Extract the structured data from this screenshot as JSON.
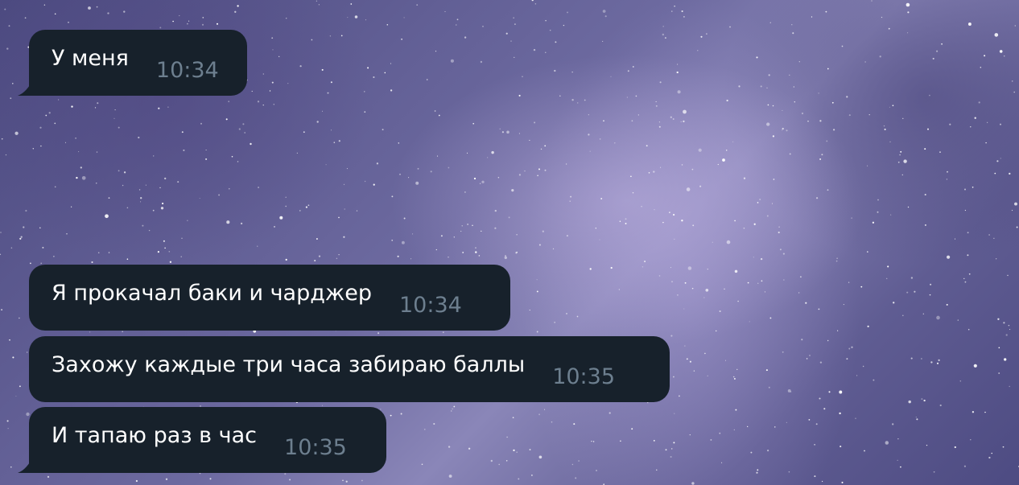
{
  "messages": [
    {
      "text": "У меня",
      "time": "10:34"
    },
    {
      "text": "Я прокачал баки и чарджер",
      "time": "10:34"
    },
    {
      "text": "Захожу каждые три часа забираю баллы",
      "time": "10:35"
    },
    {
      "text": "И тапаю раз в час",
      "time": "10:35"
    }
  ],
  "colors": {
    "bubble_background": "#17212b",
    "message_text": "#ffffff",
    "timestamp": "#6d7f8f"
  }
}
